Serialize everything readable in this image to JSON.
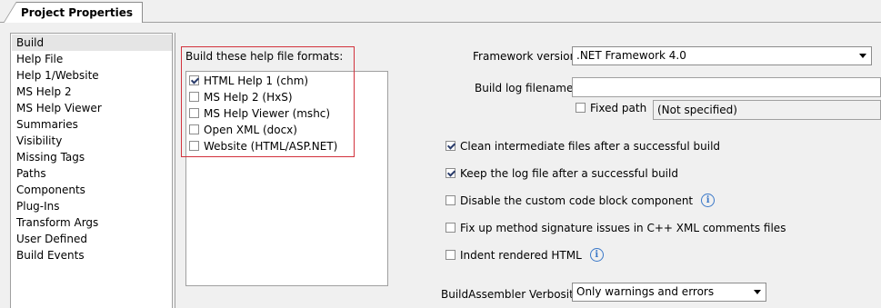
{
  "tab": {
    "title": "Project Properties"
  },
  "sidebar": {
    "selected_index": 0,
    "items": [
      {
        "label": "Build"
      },
      {
        "label": "Help File"
      },
      {
        "label": "Help 1/Website"
      },
      {
        "label": "MS Help 2"
      },
      {
        "label": "MS Help Viewer"
      },
      {
        "label": "Summaries"
      },
      {
        "label": "Visibility"
      },
      {
        "label": "Missing Tags"
      },
      {
        "label": "Paths"
      },
      {
        "label": "Components"
      },
      {
        "label": "Plug-Ins"
      },
      {
        "label": "Transform Args"
      },
      {
        "label": "User Defined"
      },
      {
        "label": "Build Events"
      }
    ]
  },
  "formats": {
    "label": "Build these help file formats:",
    "items": [
      {
        "label": "HTML Help 1 (chm)",
        "checked": true
      },
      {
        "label": "MS Help 2 (HxS)",
        "checked": false
      },
      {
        "label": "MS Help Viewer (mshc)",
        "checked": false
      },
      {
        "label": "Open XML (docx)",
        "checked": false
      },
      {
        "label": "Website (HTML/ASP.NET)",
        "checked": false
      }
    ]
  },
  "framework": {
    "label": "Framework version",
    "value": ".NET Framework 4.0"
  },
  "build_log": {
    "label": "Build log filename",
    "value": "",
    "fixed_path_label": "Fixed path",
    "fixed_path_checked": false,
    "path_display": "(Not specified)"
  },
  "options": [
    {
      "label": "Clean intermediate files after a successful build",
      "checked": true,
      "info": false
    },
    {
      "label": "Keep the log file after a successful build",
      "checked": true,
      "info": false
    },
    {
      "label": "Disable the custom code block component",
      "checked": false,
      "info": true
    },
    {
      "label": "Fix up method signature issues in C++ XML comments files",
      "checked": false,
      "info": false
    },
    {
      "label": "Indent rendered HTML",
      "checked": false,
      "info": true
    }
  ],
  "verbosity": {
    "label": "BuildAssembler Verbosity",
    "value": "Only warnings and errors"
  },
  "icons": {
    "info": "info-icon",
    "dropdown": "chevron-down-icon",
    "check": "checkmark-icon"
  }
}
